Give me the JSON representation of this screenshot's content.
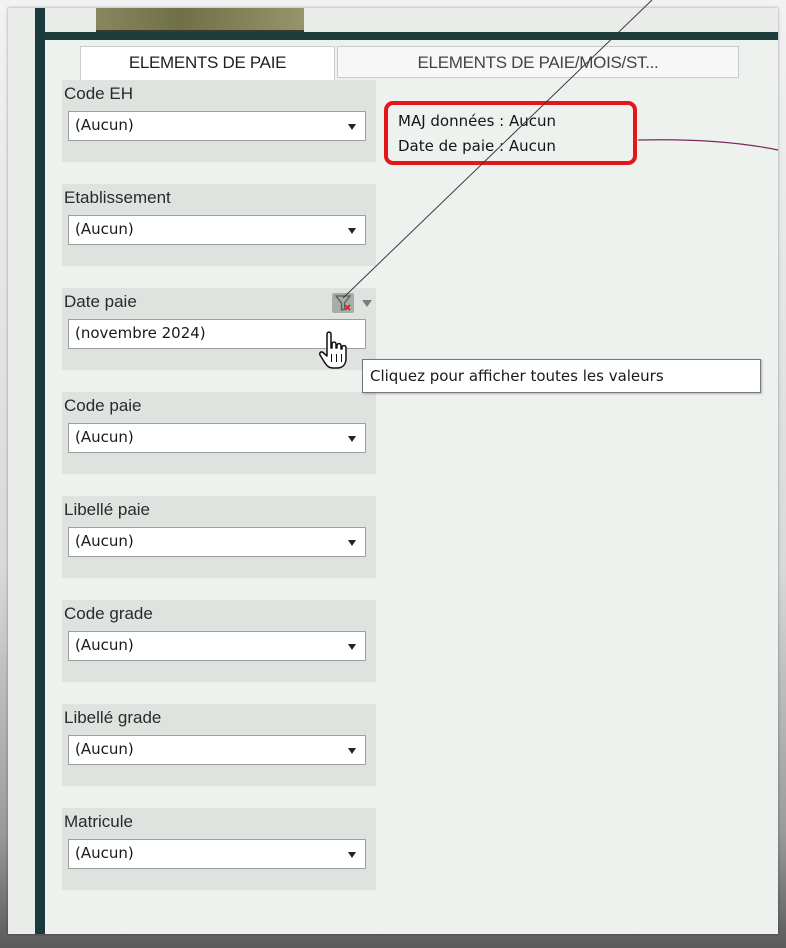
{
  "tabs": [
    {
      "label": "ELEMENTS DE PAIE",
      "active": true
    },
    {
      "label": "ELEMENTS DE PAIE/MOIS/ST...",
      "active": false
    }
  ],
  "filters": [
    {
      "label": "Code EH",
      "value": "(Aucun)"
    },
    {
      "label": "Etablissement",
      "value": "(Aucun)"
    },
    {
      "label": "Date paie",
      "value": "(novembre 2024)"
    },
    {
      "label": "Code paie",
      "value": "(Aucun)"
    },
    {
      "label": "Libellé paie",
      "value": "(Aucun)"
    },
    {
      "label": "Code grade",
      "value": "(Aucun)"
    },
    {
      "label": "Libellé grade",
      "value": "(Aucun)"
    },
    {
      "label": "Matricule",
      "value": "(Aucun)"
    }
  ],
  "info": {
    "maj": "MAJ données : Aucun",
    "date": "Date de paie  : Aucun"
  },
  "tooltip": "Cliquez pour afficher toutes les valeurs",
  "icons": {
    "clear_filter": "clear-filter-icon",
    "dropdown": "chevron-down-icon",
    "cursor": "hand-cursor-icon"
  },
  "colors": {
    "highlight": "#e3161b",
    "sidebar": "#1a3b3b",
    "annotation_line": "#7a2a5a"
  }
}
